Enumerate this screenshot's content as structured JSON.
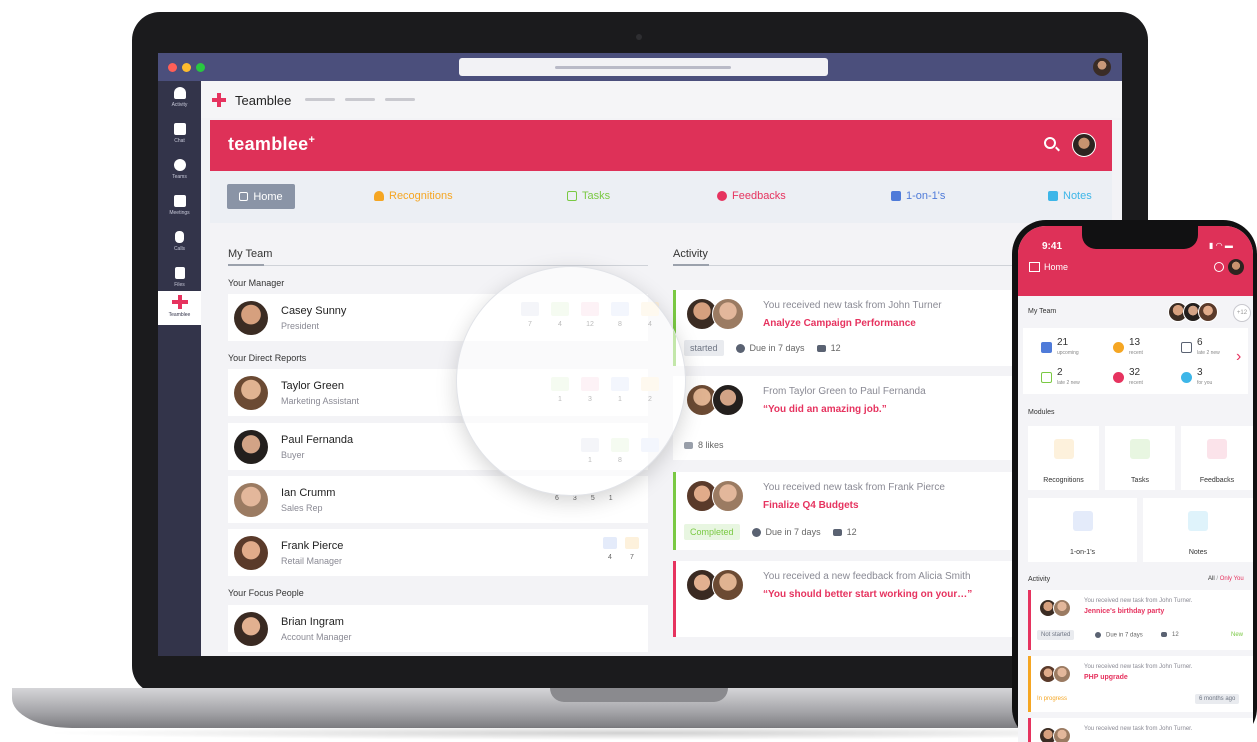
{
  "colors": {
    "brand": "#de3158",
    "accent_red": "#e6335f",
    "green": "#7ac943",
    "orange": "#f5a623",
    "blue": "#4f7bd9",
    "teams_rail": "#33344a",
    "teams_titlebar": "#4b4f7c"
  },
  "teams": {
    "rail": [
      {
        "label": "Activity",
        "icon": "bell-icon"
      },
      {
        "label": "Chat",
        "icon": "chat-icon"
      },
      {
        "label": "Teams",
        "icon": "teams-icon"
      },
      {
        "label": "Meetings",
        "icon": "calendar-icon"
      },
      {
        "label": "Calls",
        "icon": "phone-icon"
      },
      {
        "label": "Files",
        "icon": "file-icon"
      },
      {
        "label": "Teamblee",
        "icon": "teamblee-plus-icon"
      }
    ],
    "app_name": "Teamblee"
  },
  "banner": {
    "brand": "teamblee",
    "brand_mark": "+"
  },
  "nav": {
    "home": "Home",
    "recognitions": "Recognitions",
    "tasks": "Tasks",
    "feedbacks": "Feedbacks",
    "one_on_ones": "1-on-1's",
    "notes": "Notes"
  },
  "my_team": {
    "title": "My Team",
    "manager_heading": "Your Manager",
    "manager": {
      "name": "Casey Sunny",
      "role": "President",
      "counts": [
        "7",
        "4",
        "12",
        "8",
        "4"
      ]
    },
    "reports_heading": "Your Direct Reports",
    "reports": [
      {
        "name": "Taylor Green",
        "role": "Marketing Assistant",
        "counts": [
          "1",
          "3",
          "1",
          "2"
        ]
      },
      {
        "name": "Paul Fernanda",
        "role": "Buyer",
        "counts": [
          "1",
          "8"
        ]
      },
      {
        "name": "Ian Crumm",
        "role": "Sales Rep",
        "counts": [
          "6",
          "3",
          "5",
          "1"
        ]
      },
      {
        "name": "Frank Pierce",
        "role": "Retail Manager",
        "counts": [
          "4",
          "7"
        ]
      }
    ],
    "focus_heading": "Your Focus People",
    "focus": [
      {
        "name": "Brian Ingram",
        "role": "Account Manager"
      }
    ]
  },
  "activity": {
    "title": "Activity",
    "items": [
      {
        "head": "You received new task from John Turner",
        "title": "Analyze Campaign Performance",
        "status": "started",
        "due": "Due in 7 days",
        "comments": "12"
      },
      {
        "head": "From Taylor Green to Paul Fernanda",
        "title": "“You did an amazing job.”",
        "likes": "8 likes"
      },
      {
        "head": "You received new task from Frank Pierce",
        "title": "Finalize Q4 Budgets",
        "status": "Completed",
        "due": "Due in 7 days",
        "comments": "12"
      },
      {
        "head": "You received a new feedback from Alicia Smith",
        "title": "“You should better start working on your…”"
      }
    ]
  },
  "phone": {
    "time": "9:41",
    "header": "Home",
    "my_team": "My Team",
    "team_more": "+12",
    "stats": [
      {
        "value": "21",
        "label": "upcoming"
      },
      {
        "value": "13",
        "label": "recent"
      },
      {
        "value": "6",
        "label": "late 2 new"
      },
      {
        "value": "2",
        "label": "late 2 new"
      },
      {
        "value": "32",
        "label": "recent"
      },
      {
        "value": "3",
        "label": "for you"
      }
    ],
    "modules_title": "Modules",
    "modules": [
      "Recognitions",
      "Tasks",
      "Feedbacks",
      "1-on-1's",
      "Notes"
    ],
    "activity_title": "Activity",
    "filter_all": "All",
    "filter_sep": " / ",
    "filter_only": "Only You",
    "items": [
      {
        "head": "You received new task from John Turner.",
        "title": "Jennice's birthday party",
        "status": "Not started",
        "due": "Due in 7 days",
        "comments": "12",
        "tag": "New"
      },
      {
        "head": "You received new task from John Turner.",
        "title": "PHP upgrade",
        "status": "In progress",
        "time": "6 months ago"
      },
      {
        "head": "You received new task from John Turner."
      }
    ]
  }
}
